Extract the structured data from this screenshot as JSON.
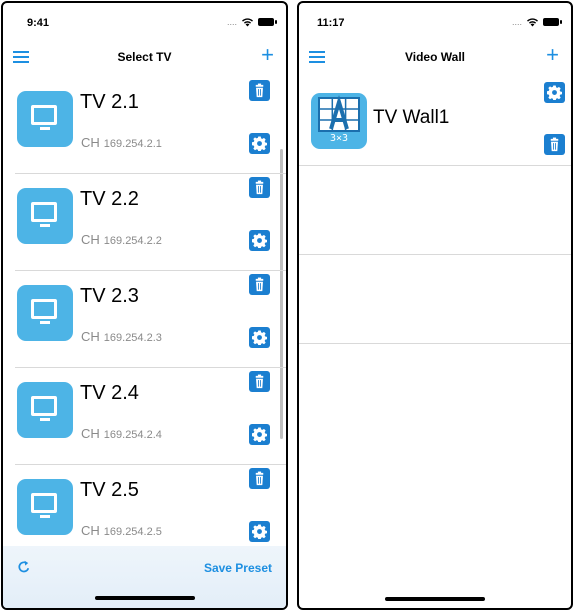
{
  "left": {
    "status_time": "9:41",
    "title": "Select TV",
    "tvs": [
      {
        "name": "TV 2.1",
        "ch": "CH",
        "ip": "169.254.2.1"
      },
      {
        "name": "TV 2.2",
        "ch": "CH",
        "ip": "169.254.2.2"
      },
      {
        "name": "TV 2.3",
        "ch": "CH",
        "ip": "169.254.2.3"
      },
      {
        "name": "TV 2.4",
        "ch": "CH",
        "ip": "169.254.2.4"
      },
      {
        "name": "TV 2.5",
        "ch": "CH",
        "ip": "169.254.2.5"
      }
    ],
    "save_label": "Save Preset",
    "plus": "+"
  },
  "right": {
    "status_time": "11:17",
    "title": "Video Wall",
    "plus": "+",
    "walls": [
      {
        "name": "TV Wall1",
        "badge": "3×3"
      }
    ]
  },
  "colors": {
    "accent": "#1d8fe1",
    "tile": "#4db4e6",
    "button": "#1b7fd0"
  },
  "icons": [
    "menu-icon",
    "plus-icon",
    "tv-icon",
    "trash-icon",
    "gear-icon",
    "refresh-icon",
    "video-wall-icon",
    "wifi-icon",
    "battery-icon"
  ]
}
